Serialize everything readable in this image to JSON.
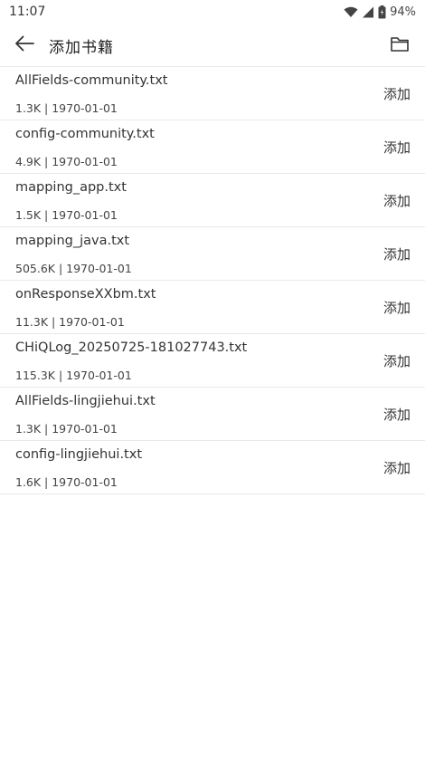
{
  "status_bar": {
    "time": "11:07",
    "battery": "94%",
    "icons": [
      "wifi-icon",
      "signal-icon",
      "battery-icon"
    ]
  },
  "app_bar": {
    "title": "添加书籍",
    "back_icon": "arrow-left-icon",
    "folder_icon": "folder-icon"
  },
  "files": [
    {
      "name": "AllFields-community.txt",
      "meta": "1.3K | 1970-01-01",
      "action": "添加"
    },
    {
      "name": "config-community.txt",
      "meta": "4.9K | 1970-01-01",
      "action": "添加"
    },
    {
      "name": "mapping_app.txt",
      "meta": "1.5K | 1970-01-01",
      "action": "添加"
    },
    {
      "name": "mapping_java.txt",
      "meta": "505.6K | 1970-01-01",
      "action": "添加"
    },
    {
      "name": "onResponseXXbm.txt",
      "meta": "11.3K | 1970-01-01",
      "action": "添加"
    },
    {
      "name": "CHiQLog_20250725-181027743.txt",
      "meta": "115.3K | 1970-01-01",
      "action": "添加"
    },
    {
      "name": "AllFields-lingjiehui.txt",
      "meta": "1.3K | 1970-01-01",
      "action": "添加"
    },
    {
      "name": "config-lingjiehui.txt",
      "meta": "1.6K | 1970-01-01",
      "action": "添加"
    }
  ]
}
